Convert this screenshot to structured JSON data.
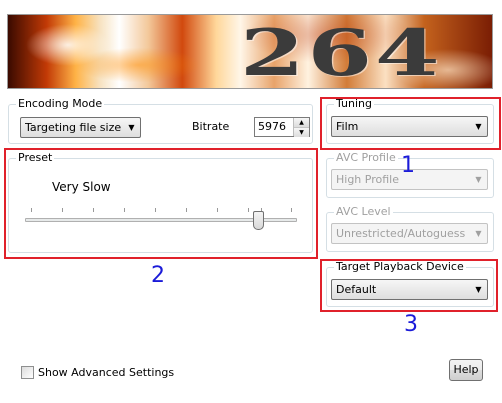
{
  "banner": {
    "logo_text": "264"
  },
  "encoding_mode": {
    "title": "Encoding Mode",
    "mode_value": "Targeting file size",
    "bitrate_label": "Bitrate",
    "bitrate_value": "5976"
  },
  "preset": {
    "title": "Preset",
    "value_label": "Very Slow",
    "slider_position": 0.86
  },
  "tuning": {
    "title": "Tuning",
    "value": "Film"
  },
  "avc_profile": {
    "title": "AVC Profile",
    "value": "High Profile"
  },
  "avc_level": {
    "title": "AVC Level",
    "value": "Unrestricted/Autoguess"
  },
  "target_device": {
    "title": "Target Playback Device",
    "value": "Default"
  },
  "annotations": {
    "one": "1",
    "two": "2",
    "three": "3"
  },
  "footer": {
    "show_advanced_label": "Show Advanced Settings",
    "help_label": "Help"
  },
  "colors": {
    "annotation_box": "#e0212b",
    "annotation_number": "#1b1bd8"
  }
}
